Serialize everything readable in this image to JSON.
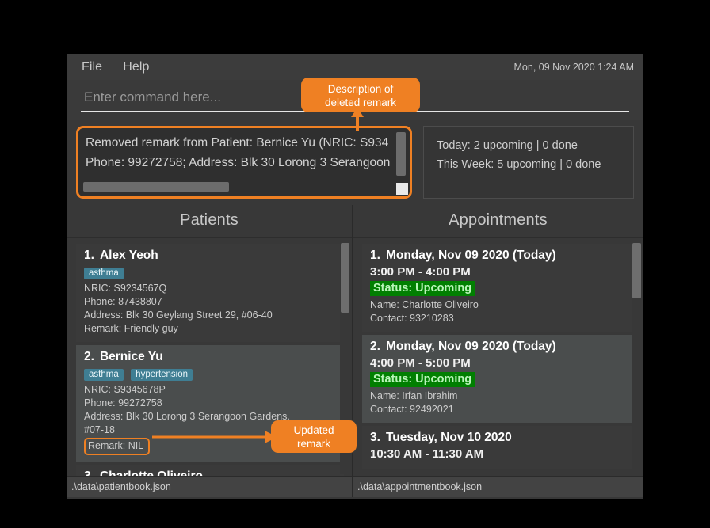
{
  "window": {
    "clock": "Mon, 09 Nov 2020 1:24 AM",
    "menu": [
      {
        "label": "File"
      },
      {
        "label": "Help"
      }
    ]
  },
  "command": {
    "placeholder": "Enter command here...",
    "value": ""
  },
  "result_box": {
    "line1": "Removed remark from Patient: Bernice Yu (NRIC: S934",
    "line2": "Phone: 99272758; Address: Blk 30 Lorong 3 Serangoon"
  },
  "status_summary": {
    "today": "Today: 2 upcoming | 0 done",
    "this_week": "This Week: 5 upcoming | 0 done"
  },
  "patients_panel": {
    "title": "Patients",
    "status_path": ".\\data\\patientbook.json",
    "items": [
      {
        "index": "1.",
        "name": "Alex Yeoh",
        "tags": [
          "asthma"
        ],
        "nric": "NRIC: S9234567Q",
        "phone": "Phone: 87438807",
        "address": "Address: Blk 30 Geylang Street 29, #06-40",
        "address2": "",
        "remark": "Remark: Friendly guy",
        "selected": false,
        "remark_highlighted": false
      },
      {
        "index": "2.",
        "name": "Bernice Yu",
        "tags": [
          "asthma",
          "hypertension"
        ],
        "nric": "NRIC: S9345678P",
        "phone": "Phone: 99272758",
        "address": "Address: Blk 30 Lorong 3 Serangoon Gardens,",
        "address2": "#07-18",
        "remark": "Remark: NIL",
        "selected": true,
        "remark_highlighted": true
      },
      {
        "index": "3.",
        "name": "Charlotte Oliveiro",
        "tags": [],
        "nric": "",
        "phone": "",
        "address": "",
        "address2": "",
        "remark": "",
        "selected": false,
        "remark_highlighted": false
      }
    ]
  },
  "appointments_panel": {
    "title": "Appointments",
    "status_path": ".\\data\\appointmentbook.json",
    "items": [
      {
        "index": "1.",
        "date": "Monday, Nov 09 2020 (Today)",
        "time": "3:00 PM - 4:00 PM",
        "status": "Status: Upcoming",
        "name": "Name: Charlotte Oliveiro",
        "contact": "Contact: 93210283",
        "selected": false
      },
      {
        "index": "2.",
        "date": "Monday, Nov 09 2020 (Today)",
        "time": "4:00 PM - 5:00 PM",
        "status": "Status: Upcoming",
        "name": "Name: Irfan Ibrahim",
        "contact": "Contact: 92492021",
        "selected": true
      },
      {
        "index": "3.",
        "date": "Tuesday, Nov 10 2020",
        "time": "10:30 AM - 11:30 AM",
        "status": "",
        "name": "",
        "contact": "",
        "selected": false
      }
    ]
  },
  "callouts": {
    "deleted_remark_line1": "Description of",
    "deleted_remark_line2": "deleted remark",
    "updated_remark_line1": "Updated",
    "updated_remark_line2": "remark"
  },
  "colors": {
    "accent_orange": "#ef8023",
    "tag_blue": "#3f7e93",
    "status_green_bg": "#017f01",
    "status_green_fg": "#b9f5b9",
    "window_bg": "#383838"
  }
}
